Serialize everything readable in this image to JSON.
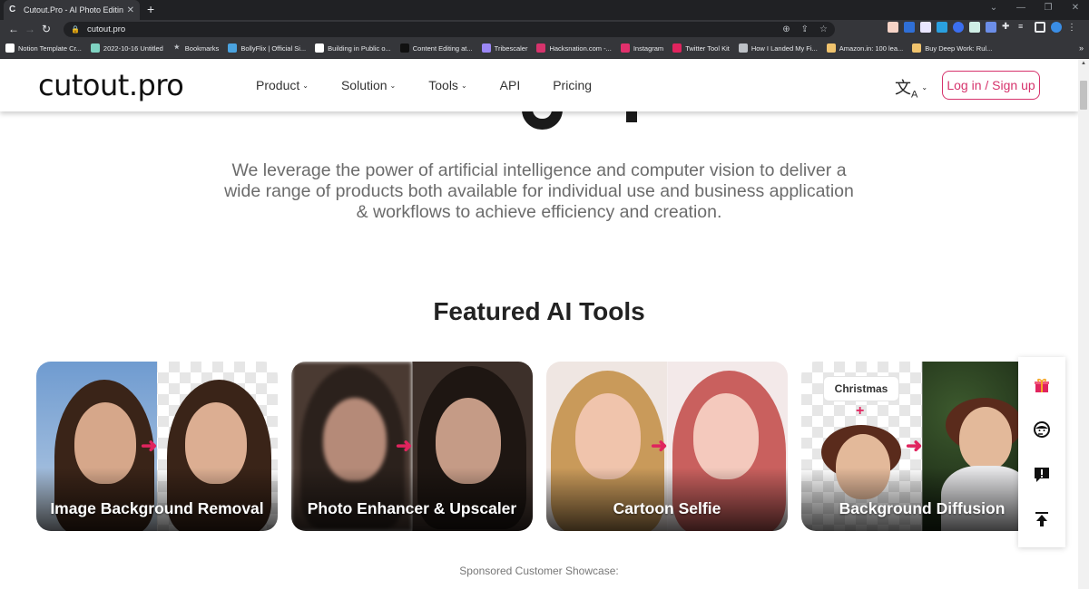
{
  "browser": {
    "tab_title": "Cutout.Pro - AI Photo Editing | V",
    "url": "cutout.pro",
    "bookmarks": [
      {
        "label": "Notion Template Cr...",
        "icon": "notion-icon",
        "color": "#ffffff"
      },
      {
        "label": "2022-10-16 Untitled",
        "icon": "c-doc-icon",
        "color": "#7fd3c2"
      },
      {
        "label": "Bookmarks",
        "icon": "star-icon",
        "color": "#bdc1c6"
      },
      {
        "label": "BollyFlix | Official Si...",
        "icon": "bollyflix-icon",
        "color": "#4aa3df"
      },
      {
        "label": "Building in Public o...",
        "icon": "ih-icon",
        "color": "#ffffff"
      },
      {
        "label": "Content Editing at...",
        "icon": "diamond-icon",
        "color": "#111111"
      },
      {
        "label": "Tribescaler",
        "icon": "tribescaler-icon",
        "color": "#9b87f5"
      },
      {
        "label": "Hacksnation.com -...",
        "icon": "flag-icon",
        "color": "#d6336c"
      },
      {
        "label": "Instagram",
        "icon": "instagram-icon",
        "color": "#e1306c"
      },
      {
        "label": "Twitter Tool Kit",
        "icon": "toolkit-icon",
        "color": "#e0245e"
      },
      {
        "label": "How I Landed My Fi...",
        "icon": "a-icon",
        "color": "#bdc1c6"
      },
      {
        "label": "Amazon.in: 100 lea...",
        "icon": "amazon-icon",
        "color": "#f0c36d"
      },
      {
        "label": "Buy Deep Work: Rul...",
        "icon": "amazon-icon",
        "color": "#f0c36d"
      }
    ],
    "bookmarks_more": "»"
  },
  "header": {
    "logo": "cutout.pro",
    "nav": [
      {
        "label": "Product",
        "dropdown": true
      },
      {
        "label": "Solution",
        "dropdown": true
      },
      {
        "label": "Tools",
        "dropdown": true
      },
      {
        "label": "API",
        "dropdown": false
      },
      {
        "label": "Pricing",
        "dropdown": false
      }
    ],
    "language_icon": "translate-icon",
    "login_label": "Log in / Sign up",
    "accent_color": "#d6336c"
  },
  "main": {
    "description": "We leverage the power of artificial intelligence and computer vision to deliver a wide range of products both available for individual use and business application & workflows to achieve efficiency and creation.",
    "featured_title": "Featured AI Tools",
    "tools": [
      {
        "label": "Image Background Removal"
      },
      {
        "label": "Photo Enhancer & Upscaler"
      },
      {
        "label": "Cartoon Selfie"
      },
      {
        "label": "Background Diffusion",
        "tag": "Christmas"
      }
    ],
    "sponsored": "Sponsored Customer Showcase:"
  },
  "floatbar": {
    "items": [
      "gift-icon",
      "customer-support-icon",
      "feedback-icon",
      "back-to-top-icon"
    ]
  }
}
